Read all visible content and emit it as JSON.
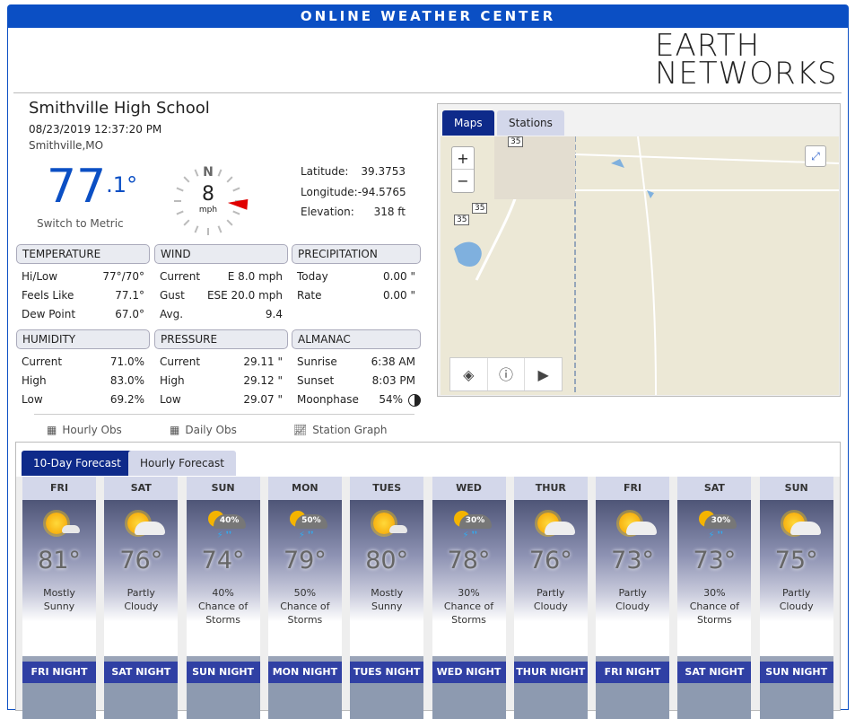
{
  "header": {
    "title": "ONLINE WEATHER CENTER"
  },
  "logo": {
    "line1": "EARTH",
    "line2": "NETWORKS"
  },
  "station": {
    "name": "Smithville High School",
    "datetime": "08/23/2019 12:37:20 PM",
    "city": "Smithville,MO",
    "temp_main": "77",
    "temp_decimal": ".1°",
    "switch_label": "Switch to Metric"
  },
  "wind_gauge": {
    "dir": "N",
    "speed": "8",
    "unit": "mph",
    "arrow_deg": 95
  },
  "location": {
    "lat_label": "Latitude:",
    "lat": "39.3753",
    "lon_label": "Longitude:",
    "lon": "-94.5765",
    "elev_label": "Elevation:",
    "elev": "318 ft"
  },
  "sections": [
    {
      "title": "TEMPERATURE",
      "rows": [
        [
          "Hi/Low",
          "77°/70°"
        ],
        [
          "Feels Like",
          "77.1°"
        ],
        [
          "Dew Point",
          "67.0°"
        ]
      ]
    },
    {
      "title": "WIND",
      "rows": [
        [
          "Current",
          "E 8.0 mph"
        ],
        [
          "Gust",
          "ESE 20.0 mph"
        ],
        [
          "Avg.",
          "9.4"
        ]
      ]
    },
    {
      "title": "PRECIPITATION",
      "rows": [
        [
          "Today",
          "0.00 \""
        ],
        [
          "Rate",
          "0.00 \""
        ]
      ]
    },
    {
      "title": "HUMIDITY",
      "rows": [
        [
          "Current",
          "71.0%"
        ],
        [
          "High",
          "83.0%"
        ],
        [
          "Low",
          "69.2%"
        ]
      ]
    },
    {
      "title": "PRESSURE",
      "rows": [
        [
          "Current",
          "29.11 \""
        ],
        [
          "High",
          "29.12 \""
        ],
        [
          "Low",
          "29.07 \""
        ]
      ]
    },
    {
      "title": "ALMANAC",
      "rows": [
        [
          "Sunrise",
          "6:38 AM"
        ],
        [
          "Sunset",
          "8:03 PM"
        ],
        [
          "Moonphase",
          "54%"
        ]
      ]
    }
  ],
  "links": [
    "Hourly Obs",
    "Daily Obs",
    "Station Graph"
  ],
  "map": {
    "tabs": [
      "Maps",
      "Stations"
    ],
    "zoom_in": "+",
    "zoom_out": "−",
    "shields": [
      "35",
      "35",
      "35"
    ]
  },
  "forecast": {
    "tabs": [
      "10-Day Forecast",
      "Hourly Forecast"
    ],
    "days": [
      {
        "day": "FRI",
        "temp": "81°",
        "cond": "Mostly Sunny",
        "icon": "mostly-sunny",
        "night": "FRI NIGHT"
      },
      {
        "day": "SAT",
        "temp": "76°",
        "cond": "Partly Cloudy",
        "icon": "partly-cloudy",
        "night": "SAT NIGHT"
      },
      {
        "day": "SUN",
        "temp": "74°",
        "cond": "40% Chance of Storms",
        "icon": "storm",
        "pct": "40%",
        "night": "SUN NIGHT"
      },
      {
        "day": "MON",
        "temp": "79°",
        "cond": "50% Chance of Storms",
        "icon": "storm",
        "pct": "50%",
        "night": "MON NIGHT"
      },
      {
        "day": "TUES",
        "temp": "80°",
        "cond": "Mostly Sunny",
        "icon": "mostly-sunny",
        "night": "TUES NIGHT"
      },
      {
        "day": "WED",
        "temp": "78°",
        "cond": "30% Chance of Storms",
        "icon": "storm",
        "pct": "30%",
        "night": "WED NIGHT"
      },
      {
        "day": "THUR",
        "temp": "76°",
        "cond": "Partly Cloudy",
        "icon": "partly-cloudy",
        "night": "THUR NIGHT"
      },
      {
        "day": "FRI",
        "temp": "73°",
        "cond": "Partly Cloudy",
        "icon": "partly-cloudy",
        "night": "FRI NIGHT"
      },
      {
        "day": "SAT",
        "temp": "73°",
        "cond": "30% Chance of Storms",
        "icon": "storm",
        "pct": "30%",
        "night": "SAT NIGHT"
      },
      {
        "day": "SUN",
        "temp": "75°",
        "cond": "Partly Cloudy",
        "icon": "partly-cloudy",
        "night": "SUN NIGHT"
      }
    ]
  },
  "colors": {
    "brand": "#0b4fc4",
    "night_header": "#3040a4",
    "arrow": "#e00000"
  }
}
